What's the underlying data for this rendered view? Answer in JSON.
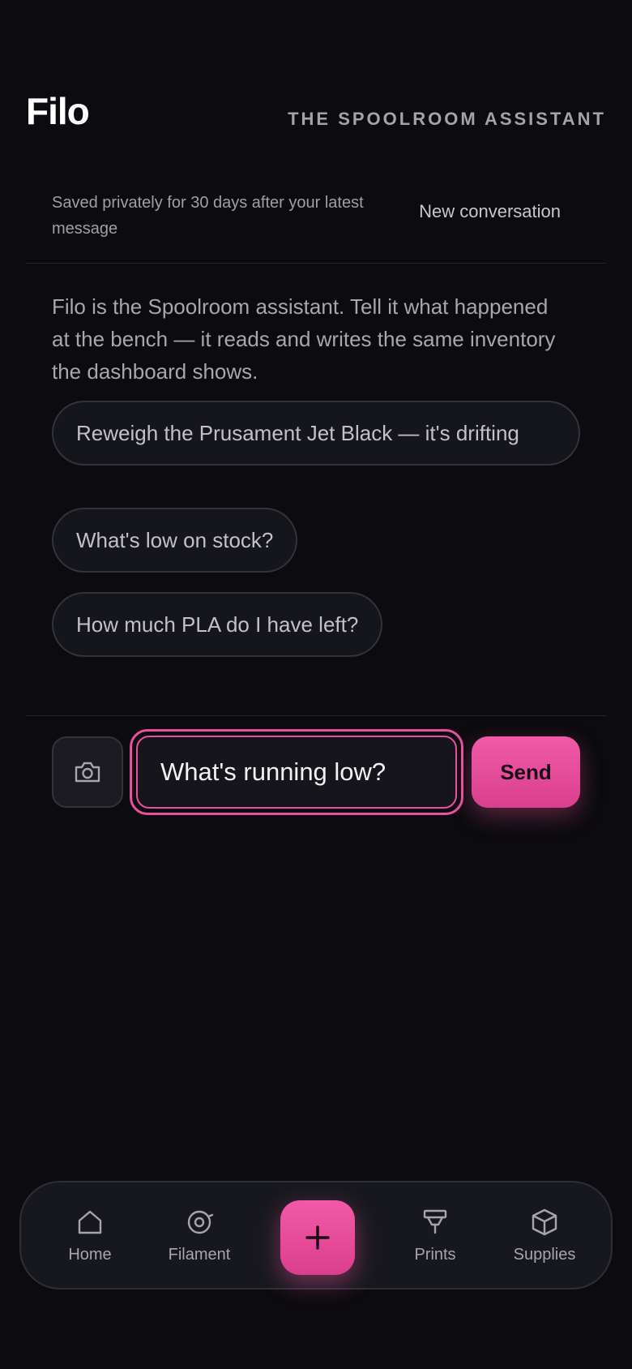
{
  "header": {
    "title": "Filo",
    "tagline": "THE SPOOLROOM ASSISTANT"
  },
  "session": {
    "note": "Saved privately for 30 days after your latest message",
    "new_conversation_label": "New conversation"
  },
  "intro": "Filo is the Spoolroom assistant. Tell it what happened at the bench — it reads and writes the same inventory the dashboard shows.",
  "suggestions": [
    "Reweigh the Prusament Jet Black — it's drifting",
    "What's low on stock?",
    "How much PLA do I have left?"
  ],
  "composer": {
    "input_value": "What's running low?",
    "send_label": "Send",
    "camera_icon": "camera-icon"
  },
  "nav": {
    "items": [
      {
        "label": "Home",
        "icon": "home-icon"
      },
      {
        "label": "Filament",
        "icon": "spool-icon"
      },
      {
        "label": "Prints",
        "icon": "nozzle-icon"
      },
      {
        "label": "Supplies",
        "icon": "box-icon"
      }
    ],
    "add_icon": "plus-icon"
  },
  "colors": {
    "accent": "#ec4f9f",
    "background": "#0c0b0f",
    "surface": "#15161c"
  }
}
